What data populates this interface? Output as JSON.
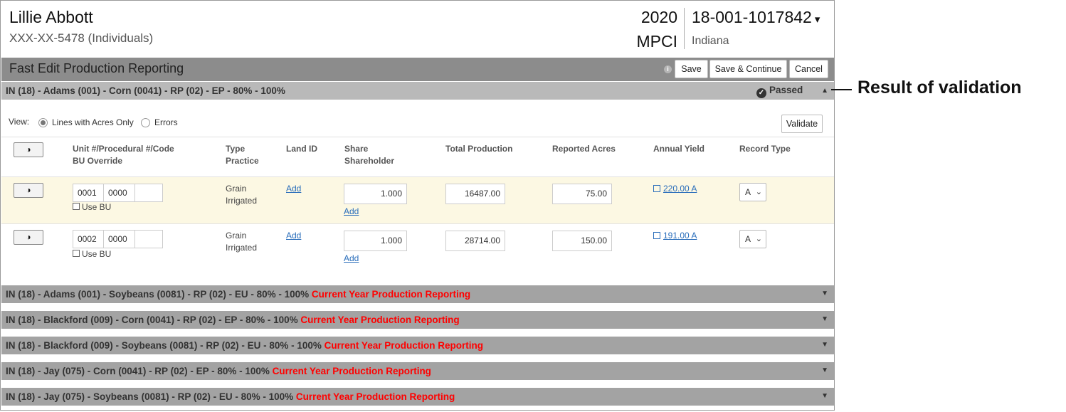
{
  "header": {
    "name": "Lillie Abbott",
    "ssn": "XXX-XX-5478 (Individuals)",
    "year": "2020",
    "plan": "MPCI",
    "policy": "18-001-1017842",
    "policy_caret": "▾",
    "state": "Indiana"
  },
  "titlebar": {
    "title": "Fast Edit Production Reporting",
    "info_icon": "i",
    "save": "Save",
    "save_continue": "Save & Continue",
    "cancel": "Cancel"
  },
  "active_segment": {
    "label": "IN (18) - Adams (001) - Corn (0041) - RP (02) - EP - 80% - 100%",
    "status": "Passed",
    "caret": "▲"
  },
  "view": {
    "label": "View:",
    "option_acres": "Lines with Acres Only",
    "option_errors": "Errors",
    "validate": "Validate"
  },
  "columns": {
    "unit_1": "Unit #/Procedural #/Code",
    "unit_2": "BU Override",
    "type_1": "Type",
    "type_2": "Practice",
    "land": "Land ID",
    "share_1": "Share",
    "share_2": "Shareholder",
    "production": "Total Production",
    "acres": "Reported Acres",
    "yield": "Annual Yield",
    "record": "Record Type"
  },
  "rows": [
    {
      "toggle": "◑",
      "unit": "0001",
      "procedural": "0000",
      "code": "",
      "use_bu": "Use BU",
      "type": "Grain",
      "practice": "Irrigated",
      "land_link": "Add",
      "share": "1.000",
      "shareholder_link": "Add",
      "production": "16487.00",
      "acres": "75.00",
      "yield": "220.00 A",
      "record_type": "A"
    },
    {
      "toggle": "◑",
      "unit": "0002",
      "procedural": "0000",
      "code": "",
      "use_bu": "Use BU",
      "type": "Grain",
      "practice": "Irrigated",
      "land_link": "Add",
      "share": "1.000",
      "shareholder_link": "Add",
      "production": "28714.00",
      "acres": "150.00",
      "yield": "191.00 A",
      "record_type": "A"
    }
  ],
  "header_toggle": "◑",
  "segments": [
    {
      "label": "IN (18) - Adams (001) - Soybeans (0081) - RP (02) - EU - 80% - 100%",
      "status": "Current Year Production Reporting",
      "caret": "▼"
    },
    {
      "label": "IN (18) - Blackford (009) - Corn (0041) - RP (02) - EP - 80% - 100%",
      "status": "Current Year Production Reporting",
      "caret": "▼"
    },
    {
      "label": "IN (18) - Blackford (009) - Soybeans (0081) - RP (02) - EU - 80% - 100%",
      "status": "Current Year Production Reporting",
      "caret": "▼"
    },
    {
      "label": "IN (18) - Jay (075) - Corn (0041) - RP (02) - EP - 80% - 100%",
      "status": "Current Year Production Reporting",
      "caret": "▼"
    },
    {
      "label": "IN (18) - Jay (075) - Soybeans (0081) - RP (02) - EU - 80% - 100%",
      "status": "Current Year Production Reporting",
      "caret": "▼"
    }
  ],
  "annotation": "Result of validation",
  "colors": {
    "status_red": "#ff0000",
    "header_bar": "#8c8c8c",
    "row_highlight": "#fcf8e3",
    "link": "#2a6ebb"
  }
}
